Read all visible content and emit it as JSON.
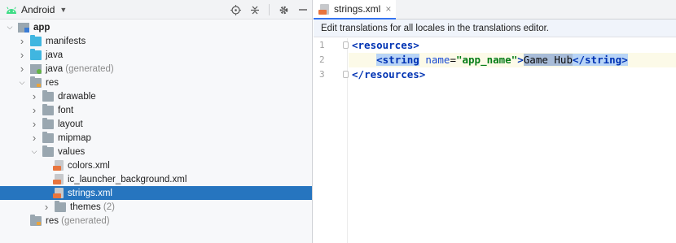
{
  "project_panel": {
    "view_label": "Android",
    "tree": [
      {
        "depth": 0,
        "expanded": true,
        "chevron": "down",
        "icon": "module-icon",
        "label": "app",
        "bold": true,
        "suffix": ""
      },
      {
        "depth": 1,
        "expanded": false,
        "chevron": "right",
        "icon": "folder-blue-icon",
        "label": "manifests",
        "suffix": ""
      },
      {
        "depth": 1,
        "expanded": false,
        "chevron": "right",
        "icon": "folder-blue-icon",
        "label": "java",
        "suffix": ""
      },
      {
        "depth": 1,
        "expanded": false,
        "chevron": "right",
        "icon": "generated-folder-icon",
        "label": "java",
        "suffix": " (generated)"
      },
      {
        "depth": 1,
        "expanded": true,
        "chevron": "down",
        "icon": "res-folder-icon",
        "label": "res",
        "suffix": ""
      },
      {
        "depth": 2,
        "expanded": false,
        "chevron": "right",
        "icon": "folder-icon",
        "label": "drawable",
        "suffix": ""
      },
      {
        "depth": 2,
        "expanded": false,
        "chevron": "right",
        "icon": "folder-icon",
        "label": "font",
        "suffix": ""
      },
      {
        "depth": 2,
        "expanded": false,
        "chevron": "right",
        "icon": "folder-icon",
        "label": "layout",
        "suffix": ""
      },
      {
        "depth": 2,
        "expanded": false,
        "chevron": "right",
        "icon": "folder-icon",
        "label": "mipmap",
        "suffix": ""
      },
      {
        "depth": 2,
        "expanded": true,
        "chevron": "down",
        "icon": "folder-icon",
        "label": "values",
        "suffix": ""
      },
      {
        "depth": 3,
        "expanded": false,
        "chevron": "",
        "icon": "xml-file-icon",
        "label": "colors.xml",
        "suffix": ""
      },
      {
        "depth": 3,
        "expanded": false,
        "chevron": "",
        "icon": "xml-file-icon",
        "label": "ic_launcher_background.xml",
        "suffix": ""
      },
      {
        "depth": 3,
        "expanded": false,
        "chevron": "",
        "icon": "xml-file-icon",
        "label": "strings.xml",
        "suffix": "",
        "selected": true
      },
      {
        "depth": 3,
        "expanded": false,
        "chevron": "right",
        "icon": "folder-icon",
        "label": "themes",
        "suffix": " (2)"
      },
      {
        "depth": 1,
        "expanded": false,
        "chevron": "",
        "icon": "res-folder-icon",
        "label": "res",
        "suffix": " (generated)"
      }
    ]
  },
  "editor": {
    "tab_label": "strings.xml",
    "banner_text": "Edit translations for all locales in the translations editor.",
    "line_numbers": [
      "1",
      "2",
      "3"
    ],
    "lines": [
      {
        "indent": "",
        "open": "<",
        "tag": "resources",
        "close": ">"
      },
      {
        "indent": "    ",
        "open": "<",
        "tag": "string",
        "attr_name": "name",
        "eq": "=",
        "attr_value": "\"app_name\"",
        "gt": ">",
        "text": "Game Hub",
        "end": "</string>"
      },
      {
        "indent": "",
        "open": "</",
        "tag": "resources",
        "close": ">"
      }
    ]
  },
  "colors": {
    "selection": "#2675bf",
    "tag": "#0033b3",
    "attribute_value": "#067d17"
  }
}
